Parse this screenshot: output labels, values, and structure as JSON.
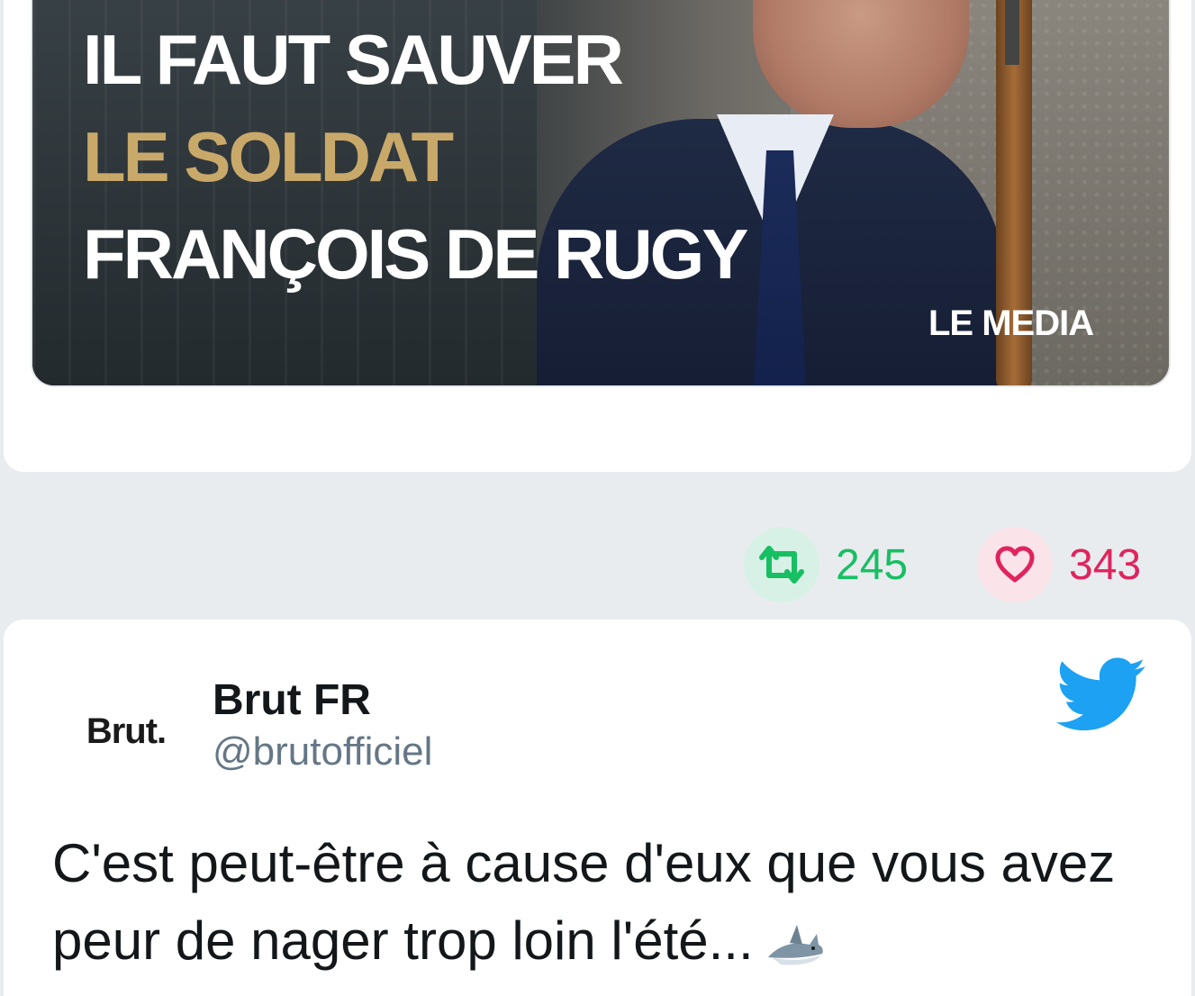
{
  "previous_tweet": {
    "media": {
      "headline": {
        "line1": "IL FAUT SAUVER",
        "line2": "LE SOLDAT",
        "line3": "FRANÇOIS DE RUGY"
      },
      "logo_text": "LE MEDIA",
      "accent_color": "#c9a96a"
    },
    "actions": {
      "retweet_count": "245",
      "like_count": "343",
      "retweet_color": "#17bf63",
      "like_color": "#e0245e"
    }
  },
  "tweet": {
    "author": {
      "avatar_text": "Brut.",
      "display_name": "Brut FR",
      "handle": "@brutofficiel"
    },
    "brand_icon": "twitter-bird-icon",
    "brand_color": "#1da1f2",
    "text": "C'est peut-être à cause d'eux que vous avez peur de nager trop loin l'été...",
    "emoji_icon": "shark-icon"
  }
}
